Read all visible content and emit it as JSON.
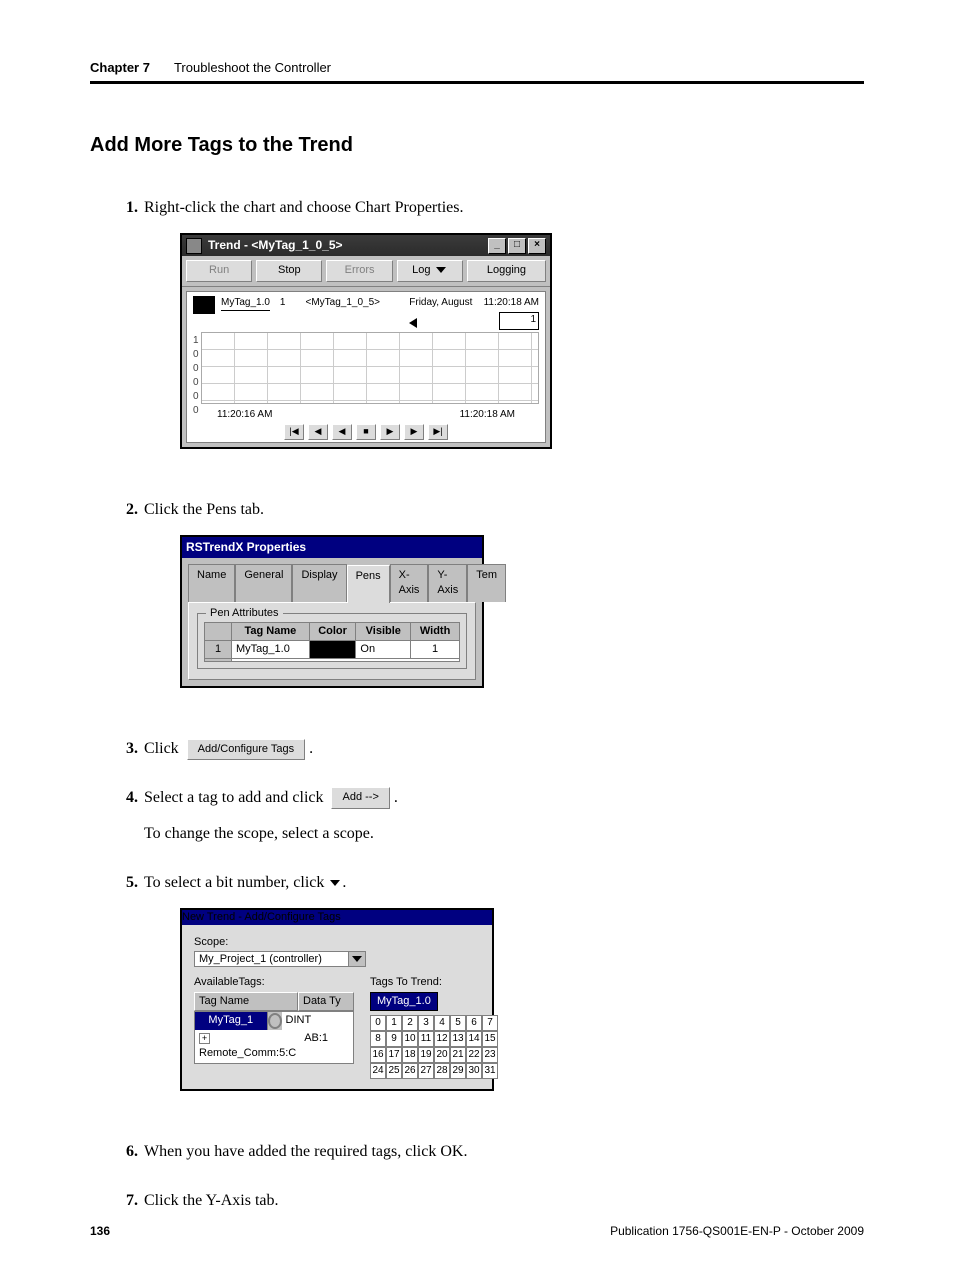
{
  "header": {
    "chapter": "Chapter 7",
    "title": "Troubleshoot the Controller"
  },
  "section_title": "Add More Tags to the Trend",
  "steps": {
    "s1": "Right-click the chart and choose Chart Properties.",
    "s2": "Click the Pens tab.",
    "s3_pre": "Click",
    "s3_btn": "Add/Configure Tags",
    "s4_pre": "Select a tag to add and click",
    "s4_btn": "Add -->",
    "s4_note": "To change the scope, select a scope.",
    "s5_pre": "To select a bit number, click",
    "s6": "When you have added the required tags, click OK.",
    "s7": "Click the Y-Axis tab."
  },
  "win1": {
    "title": "Trend - <MyTag_1_0_5>",
    "toolbar": {
      "run": "Run",
      "stop": "Stop",
      "errors": "Errors",
      "log": "Log",
      "logging": "Logging"
    },
    "chart": {
      "tag_small": "MyTag_1.0",
      "tag_main": "<MyTag_1_0_5>",
      "day": "Friday, August",
      "time": "11:20:18 AM",
      "one": "1",
      "ticks": [
        "1",
        "0",
        "0",
        "0",
        "0",
        "0"
      ],
      "t_left": "11:20:16 AM",
      "t_right": "11:20:18 AM"
    }
  },
  "dlg2": {
    "title": "RSTrendX Properties",
    "tabs": [
      "Name",
      "General",
      "Display",
      "Pens",
      "X-Axis",
      "Y-Axis",
      "Tem"
    ],
    "group": "Pen Attributes",
    "cols": [
      "",
      "Tag Name",
      "Color",
      "Visible",
      "Width"
    ],
    "row": {
      "idx": "1",
      "tag": "MyTag_1.0",
      "color": "",
      "visible": "On",
      "width": "1"
    }
  },
  "dlg3": {
    "title": "New Trend - Add/Configure Tags",
    "scope_label": "Scope:",
    "scope_value": "My_Project_1 (controller)",
    "avail_label": "AvailableTags:",
    "trend_label": "Tags To Trend:",
    "hdr_tag": "Tag Name",
    "hdr_type": "Data Ty",
    "rows": [
      {
        "name": "MyTag_1",
        "type": "DINT",
        "sel": true
      },
      {
        "name": "Remote_Comm:5:C",
        "type": "AB:1",
        "sel": false
      }
    ],
    "selected_tag": "MyTag_1.0",
    "bits": [
      "0",
      "1",
      "2",
      "3",
      "4",
      "5",
      "6",
      "7",
      "8",
      "9",
      "10",
      "11",
      "12",
      "13",
      "14",
      "15",
      "16",
      "17",
      "18",
      "19",
      "20",
      "21",
      "22",
      "23",
      "24",
      "25",
      "26",
      "27",
      "28",
      "29",
      "30",
      "31"
    ]
  },
  "footer": {
    "page": "136",
    "pub": "Publication 1756-QS001E-EN-P - October 2009"
  }
}
